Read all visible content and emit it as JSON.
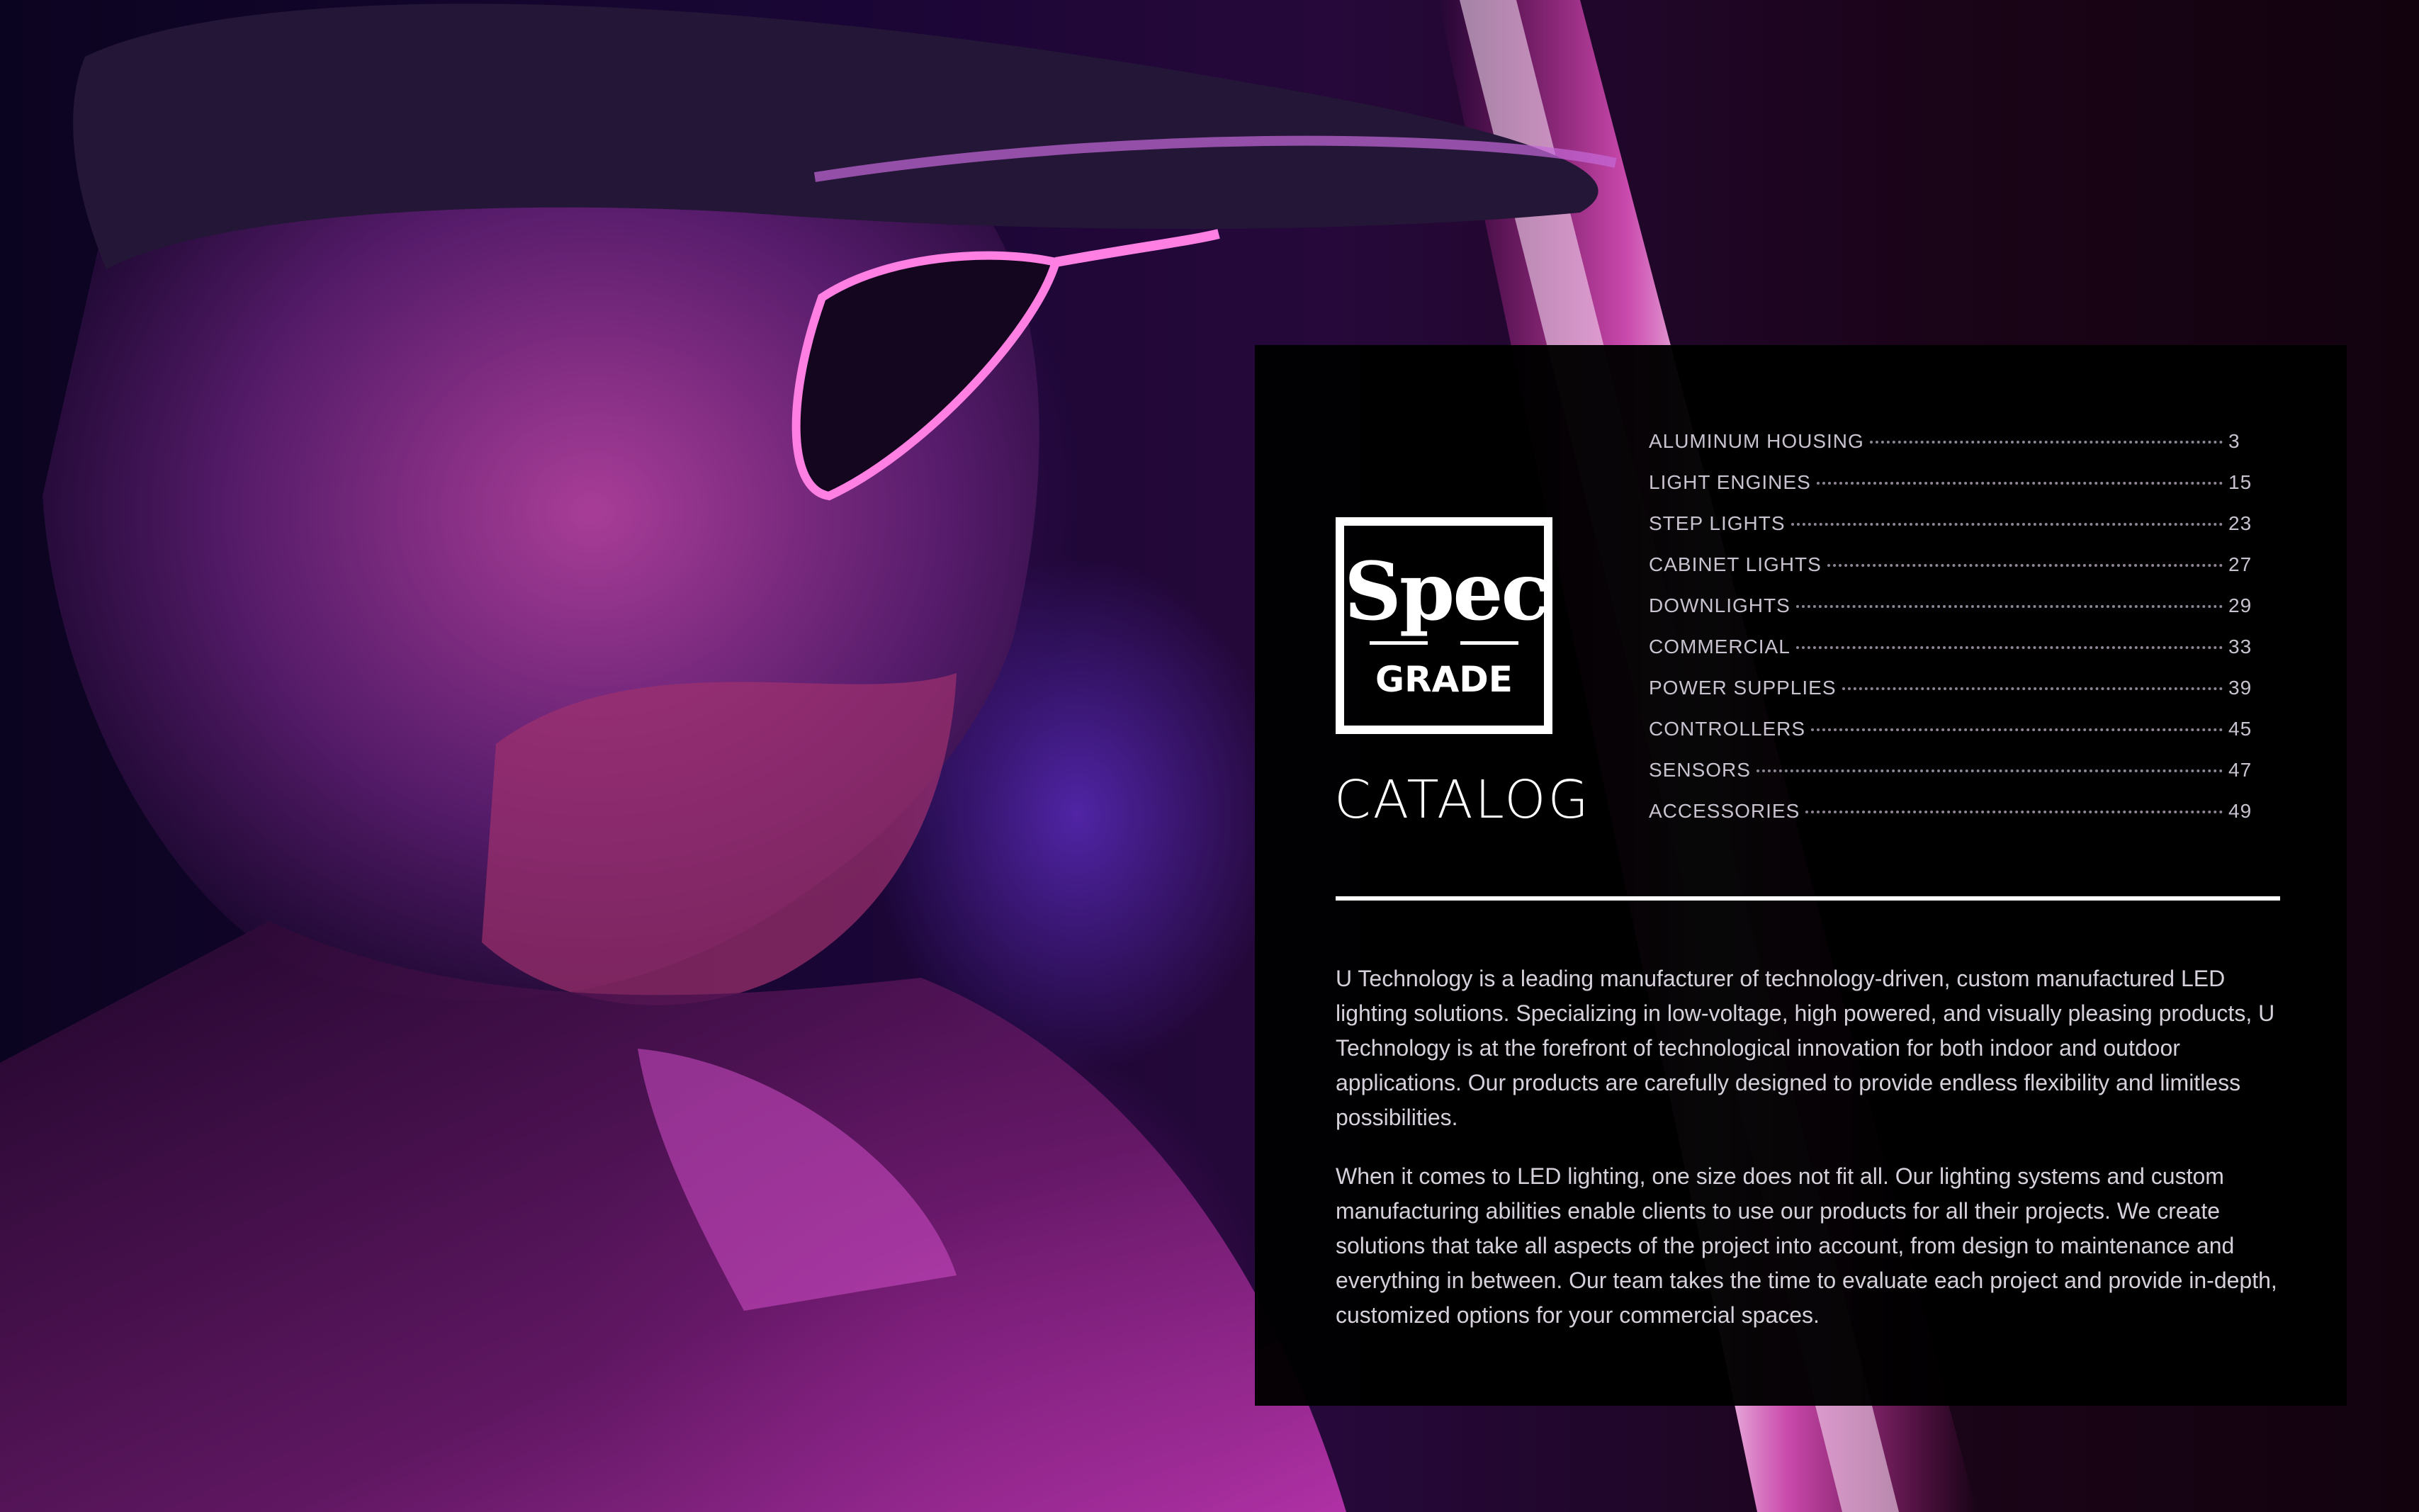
{
  "colors": {
    "panel_bg": "#000000",
    "text_white": "#ffffff",
    "text_gray": "#c9c2cf",
    "neon_pink": "#ff4fd8",
    "neon_purple": "#7a3cff"
  },
  "logo": {
    "word_top": "Spec",
    "word_bottom": "GRADE"
  },
  "title": "CATALOG",
  "toc": [
    {
      "label": "ALUMINUM HOUSING",
      "page": "3"
    },
    {
      "label": "LIGHT ENGINES",
      "page": "15"
    },
    {
      "label": "STEP LIGHTS",
      "page": "23"
    },
    {
      "label": "CABINET LIGHTS",
      "page": "27"
    },
    {
      "label": "DOWNLIGHTS",
      "page": "29"
    },
    {
      "label": "COMMERCIAL",
      "page": "33"
    },
    {
      "label": "POWER SUPPLIES",
      "page": "39"
    },
    {
      "label": "CONTROLLERS",
      "page": "45"
    },
    {
      "label": "SENSORS",
      "page": "47"
    },
    {
      "label": "ACCESSORIES",
      "page": "49"
    }
  ],
  "body": {
    "paragraph_1": "U Technology is a leading manufacturer of technology-driven, custom manufactured LED lighting solutions. Specializing in low-voltage, high powered, and visually pleasing products, U Technology is at the forefront of technological innovation for both indoor and outdoor applications. Our products are carefully designed to provide endless flexibility and limitless possibilities.",
    "paragraph_2": "When it comes to LED lighting, one size does not fit all. Our lighting systems and custom manufacturing abilities enable clients to use our products for all their projects. We create solutions that take all aspects of the project into account, from design to maintenance and everything in between. Our team takes the time to evaluate each project and provide in-depth, customized options for your commercial spaces."
  }
}
